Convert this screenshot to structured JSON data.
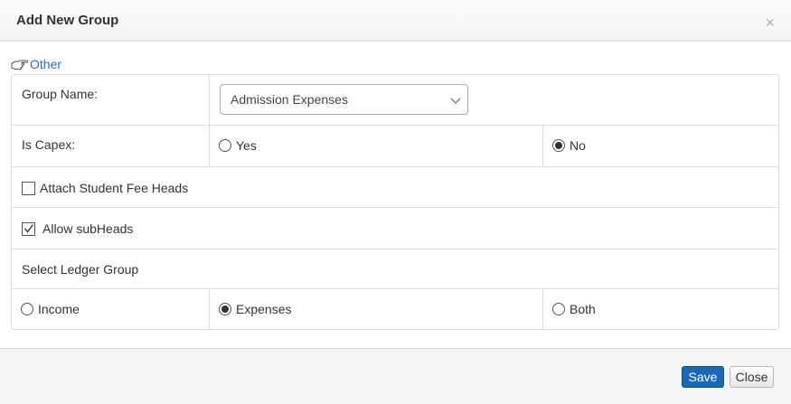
{
  "dialog": {
    "title": "Add New Group",
    "close_symbol": "×"
  },
  "section": {
    "icon": "pointing-hand-icon",
    "label": "Other"
  },
  "form": {
    "group_name": {
      "label": "Group Name:",
      "selected_value": "Admission Expenses"
    },
    "is_capex": {
      "label": "Is Capex:",
      "options": [
        {
          "label": "Yes",
          "checked": false
        },
        {
          "label": "No",
          "checked": true
        }
      ]
    },
    "attach_student_fee_heads": {
      "label": "Attach Student Fee Heads",
      "checked": false
    },
    "allow_subheads": {
      "label": "Allow subHeads",
      "checked": true
    },
    "ledger_group": {
      "label": "Select Ledger Group",
      "options": [
        {
          "label": "Income",
          "checked": false
        },
        {
          "label": "Expenses",
          "checked": true
        },
        {
          "label": "Both",
          "checked": false
        }
      ]
    }
  },
  "footer": {
    "save_label": "Save",
    "close_label": "Close"
  },
  "colors": {
    "link": "#2a6ebb",
    "primary_button": "#1967b8",
    "border": "#dddddd"
  }
}
